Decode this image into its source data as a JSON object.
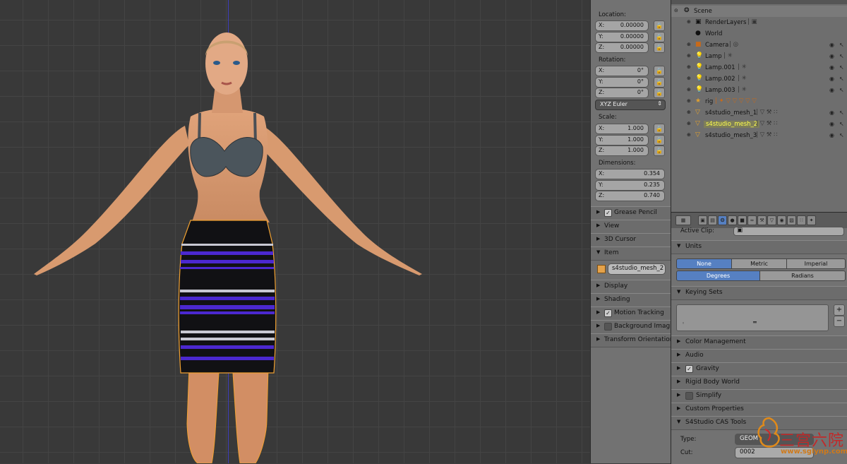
{
  "outliner": {
    "items": [
      {
        "name": "Scene",
        "extra": "",
        "icon": "scene-icon"
      },
      {
        "name": "RenderLayers",
        "extra": "",
        "icon": "render-layers-icon"
      },
      {
        "name": "World",
        "extra": "",
        "icon": "world-icon"
      },
      {
        "name": "Camera",
        "extra": "",
        "icon": "camera-icon"
      },
      {
        "name": "Lamp",
        "extra": "",
        "icon": "lamp-icon"
      },
      {
        "name": "Lamp.001",
        "extra": "",
        "icon": "lamp-icon"
      },
      {
        "name": "Lamp.002",
        "extra": "",
        "icon": "lamp-icon"
      },
      {
        "name": "Lamp.003",
        "extra": "",
        "icon": "lamp-icon"
      },
      {
        "name": "rig",
        "extra": "",
        "icon": "armature-icon"
      },
      {
        "name": "s4studio_mesh_1",
        "extra": "",
        "icon": "mesh-icon"
      },
      {
        "name": "s4studio_mesh_2",
        "extra": "",
        "icon": "mesh-icon",
        "selected": true
      },
      {
        "name": "s4studio_mesh_3",
        "extra": "",
        "icon": "mesh-icon"
      }
    ]
  },
  "transform": {
    "location_label": "Location:",
    "location": [
      {
        "k": "X:",
        "v": "0.00000"
      },
      {
        "k": "Y:",
        "v": "0.00000"
      },
      {
        "k": "Z:",
        "v": "0.00000"
      }
    ],
    "rotation_label": "Rotation:",
    "rotation": [
      {
        "k": "X:",
        "v": "0°"
      },
      {
        "k": "Y:",
        "v": "0°"
      },
      {
        "k": "Z:",
        "v": "0°"
      }
    ],
    "rotation_mode": "XYZ Euler",
    "scale_label": "Scale:",
    "scale": [
      {
        "k": "X:",
        "v": "1.000"
      },
      {
        "k": "Y:",
        "v": "1.000"
      },
      {
        "k": "Z:",
        "v": "1.000"
      }
    ],
    "dimensions_label": "Dimensions:",
    "dimensions": [
      {
        "k": "X:",
        "v": "0.354"
      },
      {
        "k": "Y:",
        "v": "0.235"
      },
      {
        "k": "Z:",
        "v": "0.740"
      }
    ]
  },
  "npanel_sections": [
    {
      "label": "Grease Pencil",
      "checkbox": true,
      "expanded": false
    },
    {
      "label": "View",
      "checkbox": false,
      "expanded": false
    },
    {
      "label": "3D Cursor",
      "checkbox": false,
      "expanded": false
    },
    {
      "label": "Item",
      "checkbox": false,
      "expanded": true
    },
    {
      "label": "Display",
      "checkbox": false,
      "expanded": false
    },
    {
      "label": "Shading",
      "checkbox": false,
      "expanded": false
    },
    {
      "label": "Motion Tracking",
      "checkbox": true,
      "expanded": false
    },
    {
      "label": "Background Imag",
      "checkbox": "off",
      "expanded": false
    },
    {
      "label": "Transform Orientation",
      "checkbox": false,
      "expanded": false
    }
  ],
  "item_name": "s4studio_mesh_2",
  "properties": {
    "active_clip_label": "Active Clip:",
    "units_title": "Units",
    "unit_system": [
      "None",
      "Metric",
      "Imperial"
    ],
    "unit_system_selected": "None",
    "rotation_units": [
      "Degrees",
      "Radians"
    ],
    "rotation_units_selected": "Degrees",
    "keying_sets_title": "Keying Sets",
    "sections": [
      {
        "label": "Color Management",
        "checkbox": false
      },
      {
        "label": "Audio",
        "checkbox": false
      },
      {
        "label": "Gravity",
        "checkbox": true
      },
      {
        "label": "Rigid Body World",
        "checkbox": false
      },
      {
        "label": "Simplify",
        "checkbox": "off"
      },
      {
        "label": "Custom Properties",
        "checkbox": false
      }
    ],
    "s4_title": "S4Studio CAS Tools",
    "type_label": "Type:",
    "type_value": "GEOM",
    "cut_label": "Cut:",
    "cut_value": "0002"
  },
  "watermark": {
    "cn": "三宫六院",
    "url": "www.sglynp.com"
  },
  "colors": {
    "selected_text": "#ffff4d",
    "accent_blue": "#5680c2",
    "outline_orange": "#f0a030",
    "skirt_purple": "#4b28d0"
  }
}
